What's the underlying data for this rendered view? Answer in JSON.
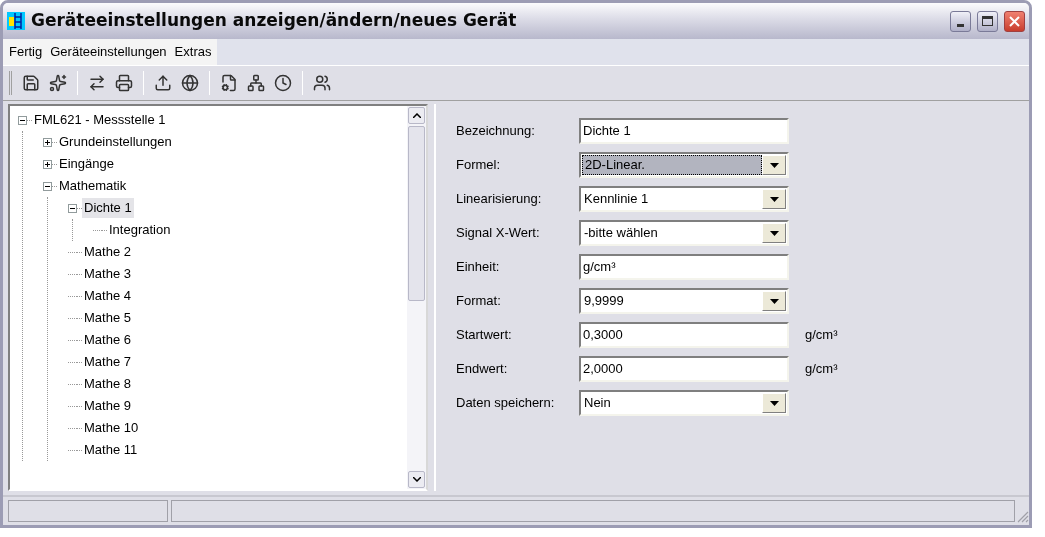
{
  "window": {
    "title": "Geräteeinstellungen anzeigen/ändern/neues Gerät"
  },
  "menu": [
    "Fertig",
    "Geräteeinstellungen",
    "Extras"
  ],
  "toolbar": [
    {
      "kind": "save"
    },
    {
      "kind": "save-flash"
    },
    {
      "kind": "sep"
    },
    {
      "kind": "transfer"
    },
    {
      "kind": "print"
    },
    {
      "kind": "sep"
    },
    {
      "kind": "upload"
    },
    {
      "kind": "globe"
    },
    {
      "kind": "sep"
    },
    {
      "kind": "properties"
    },
    {
      "kind": "network"
    },
    {
      "kind": "clock"
    },
    {
      "kind": "sep"
    },
    {
      "kind": "users"
    }
  ],
  "tree": [
    {
      "label": "FML621 - Messstelle 1",
      "expanded": true,
      "selected": false,
      "children": [
        {
          "label": "Grundeinstellungen",
          "kind": "branch",
          "expanded": false,
          "selected": false
        },
        {
          "label": "Eingänge",
          "kind": "branch",
          "expanded": false,
          "selected": false
        },
        {
          "label": "Mathematik",
          "expanded": true,
          "selected": false,
          "children": [
            {
              "label": "Dichte 1",
              "expanded": true,
              "selected": true,
              "children": [
                {
                  "label": "Integration",
                  "selected": false
                }
              ]
            },
            {
              "label": "Mathe 2",
              "selected": false
            },
            {
              "label": "Mathe 3",
              "selected": false
            },
            {
              "label": "Mathe 4",
              "selected": false
            },
            {
              "label": "Mathe 5",
              "selected": false
            },
            {
              "label": "Mathe 6",
              "selected": false
            },
            {
              "label": "Mathe 7",
              "selected": false
            },
            {
              "label": "Mathe 8",
              "selected": false
            },
            {
              "label": "Mathe 9",
              "selected": false
            },
            {
              "label": "Mathe 10",
              "selected": false
            },
            {
              "label": "Mathe 11",
              "selected": false
            }
          ]
        }
      ]
    }
  ],
  "form": [
    {
      "label": "Bezeichnung:",
      "kind": "text",
      "value": "Dichte 1",
      "focused": false
    },
    {
      "label": "Formel:",
      "kind": "select",
      "value": "2D-Linear.",
      "focused": true
    },
    {
      "label": "Linearisierung:",
      "kind": "select",
      "value": "Kennlinie 1",
      "focused": false
    },
    {
      "label": "Signal X-Wert:",
      "kind": "select",
      "value": "-bitte wählen",
      "focused": false
    },
    {
      "label": "Einheit:",
      "kind": "text",
      "value": "g/cm³",
      "focused": false
    },
    {
      "label": "Format:",
      "kind": "select",
      "value": "9,9999",
      "focused": false
    },
    {
      "label": "Startwert:",
      "kind": "text",
      "value": "0,3000",
      "focused": false,
      "unit": "g/cm³"
    },
    {
      "label": "Endwert:",
      "kind": "text",
      "value": "2,0000",
      "focused": false,
      "unit": "g/cm³"
    },
    {
      "label": "Daten speichern:",
      "kind": "select",
      "value": "Nein",
      "focused": false
    }
  ]
}
